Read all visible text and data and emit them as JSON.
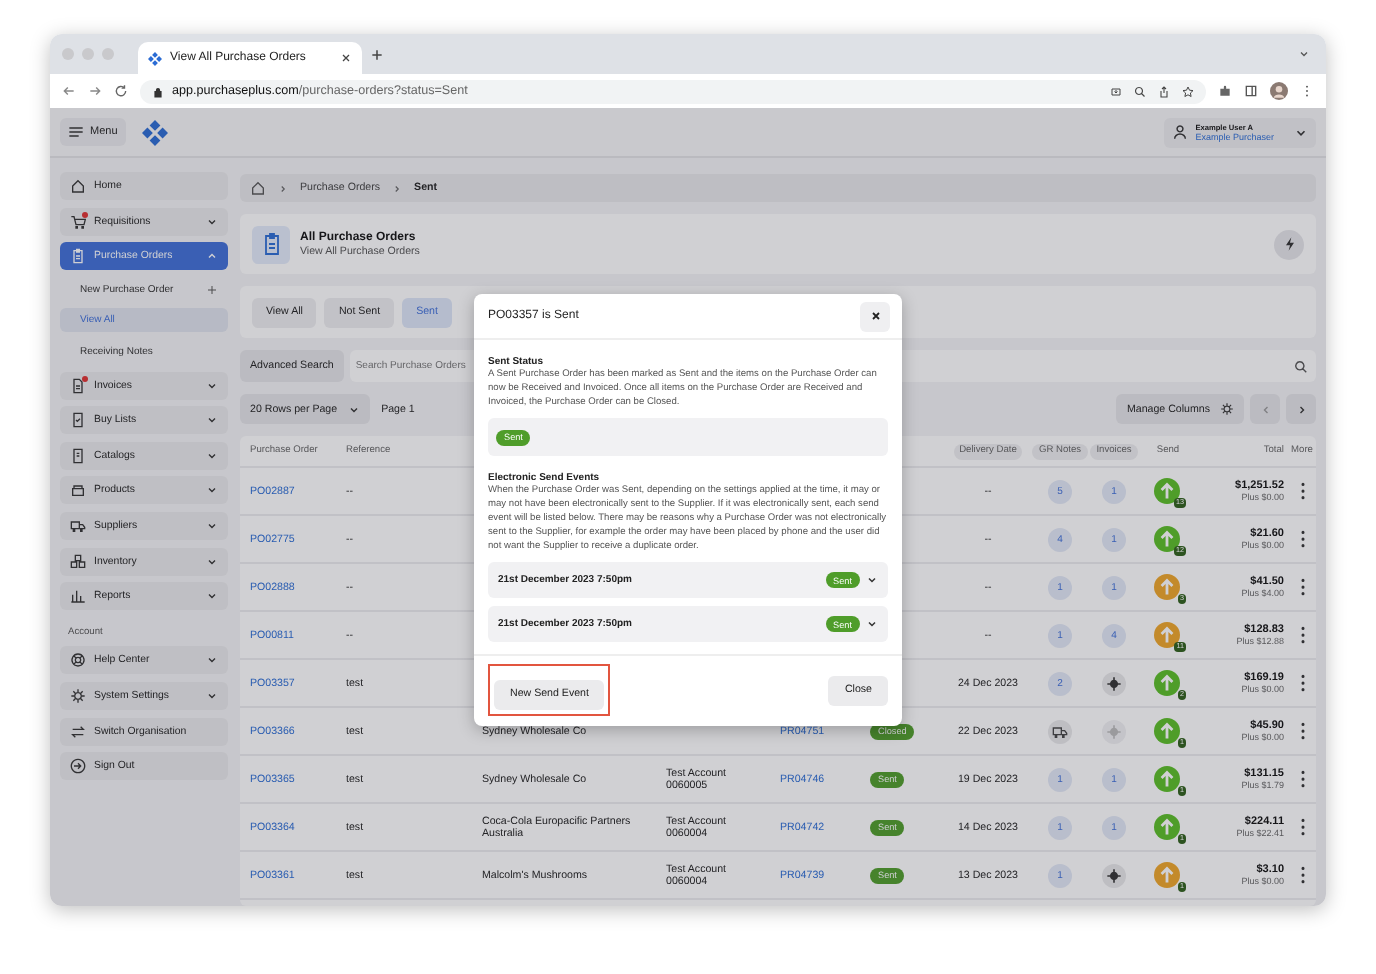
{
  "browser": {
    "tab_title": "View All Purchase Orders",
    "url": "**app.purchaseplus.com**/purchase-orders?status=Sent"
  },
  "header": {
    "menu_label": "Menu",
    "user_name": "Example User A",
    "user_role": "Example Purchaser"
  },
  "sidebar": {
    "sections": [
      {
        "items": [
          {
            "label": "Home",
            "selected": false
          },
          {
            "label": "Requisitions",
            "selected": false,
            "expanded": false,
            "notification": true
          },
          {
            "label": "Purchase Orders",
            "selected": true,
            "expanded": true,
            "notification": false,
            "children": [
              {
                "label": "New Purchase Order",
                "selected": false,
                "kind": "add"
              },
              {
                "label": "View All",
                "selected": true,
                "kind": "link"
              },
              {
                "label": "Receiving Notes",
                "selected": false,
                "kind": "link"
              }
            ]
          },
          {
            "label": "Invoices",
            "selected": false,
            "expanded": false,
            "notification": true
          },
          {
            "label": "Buy Lists",
            "selected": false,
            "expanded": false,
            "notification": false
          },
          {
            "label": "Catalogs",
            "selected": false,
            "expanded": false,
            "notification": false
          },
          {
            "label": "Products",
            "selected": false,
            "expanded": false,
            "notification": false
          },
          {
            "label": "Suppliers",
            "selected": false,
            "expanded": false,
            "notification": false
          },
          {
            "label": "Inventory",
            "selected": false,
            "expanded": false,
            "notification": false
          },
          {
            "label": "Reports",
            "selected": false,
            "expanded": false,
            "notification": false
          }
        ]
      },
      {
        "title": "Account",
        "items": [
          {
            "label": "Help Center",
            "selected": false,
            "expanded": false
          },
          {
            "label": "System Settings",
            "selected": false,
            "expanded": false
          },
          {
            "label": "Switch Organisation",
            "selected": false
          },
          {
            "label": "Sign Out",
            "selected": false
          }
        ]
      }
    ]
  },
  "breadcrumb": [
    "Purchase Orders",
    "Sent"
  ],
  "page": {
    "title": "All Purchase Orders",
    "subtitle": "View All Purchase Orders"
  },
  "filter_tabs": [
    {
      "label": "View All",
      "selected": false
    },
    {
      "label": "Not Sent",
      "selected": false
    },
    {
      "label": "Sent",
      "selected": true
    }
  ],
  "search": {
    "button": "Advanced Search",
    "placeholder": "Search Purchase Orders"
  },
  "pager": {
    "rows_per_page": "20 Rows per Page",
    "page": "Page 1",
    "manage_columns": "Manage Columns"
  },
  "table": {
    "columns": [
      "Purchase Order",
      "Reference",
      "",
      "",
      "",
      "",
      "Delivery Date",
      "GR Notes",
      "Invoices",
      "Send",
      "Total",
      "More"
    ],
    "rows": [
      {
        "po": "PO02887",
        "reference": "--",
        "delivery_date": "--",
        "gr_notes": {
          "kind": "count",
          "text": "5"
        },
        "invoices": {
          "kind": "count",
          "text": "1"
        },
        "send": {
          "count": "13",
          "color": "#4f9d2a"
        },
        "total": "$1,251.52",
        "tax": "Plus $0.00"
      },
      {
        "po": "PO02775",
        "reference": "--",
        "delivery_date": "--",
        "gr_notes": {
          "kind": "count",
          "text": "4"
        },
        "invoices": {
          "kind": "count",
          "text": "1"
        },
        "send": {
          "count": "12",
          "color": "#4f9d2a"
        },
        "total": "$21.60",
        "tax": "Plus $0.00"
      },
      {
        "po": "PO02888",
        "reference": "--",
        "delivery_date": "--",
        "gr_notes": {
          "kind": "count",
          "text": "1"
        },
        "invoices": {
          "kind": "count",
          "text": "1"
        },
        "send": {
          "count": "3",
          "color": "#c38a2b"
        },
        "total": "$41.50",
        "tax": "Plus $4.00"
      },
      {
        "po": "PO00811",
        "reference": "--",
        "delivery_date": "--",
        "gr_notes": {
          "kind": "count",
          "text": "1"
        },
        "invoices": {
          "kind": "count",
          "text": "4"
        },
        "send": {
          "count": "11",
          "color": "#c38a2b"
        },
        "total": "$128.83",
        "tax": "Plus $12.88"
      },
      {
        "po": "PO03357",
        "reference": "test",
        "delivery_date": "24 Dec 2023",
        "gr_notes": {
          "kind": "count",
          "text": "2"
        },
        "invoices": {
          "kind": "icon",
          "disabled": false
        },
        "send": {
          "count": "2",
          "color": "#4f9d2a"
        },
        "total": "$169.19",
        "tax": "Plus $0.00"
      },
      {
        "po": "PO03366",
        "reference": "test",
        "supplier": "Sydney Wholesale Co",
        "pr": "PR04751",
        "status": "Closed",
        "delivery_date": "22 Dec 2023",
        "gr_notes": {
          "kind": "truck"
        },
        "invoices": {
          "kind": "icon",
          "disabled": true
        },
        "send": {
          "count": "1",
          "color": "#4f9d2a"
        },
        "total": "$45.90",
        "tax": "Plus $0.00"
      },
      {
        "po": "PO03365",
        "reference": "test",
        "supplier": "Sydney Wholesale Co",
        "account": "Test Account 0060005",
        "pr": "PR04746",
        "status": "Sent",
        "delivery_date": "19 Dec 2023",
        "gr_notes": {
          "kind": "count",
          "text": "1"
        },
        "invoices": {
          "kind": "count",
          "text": "1"
        },
        "send": {
          "count": "1",
          "color": "#4f9d2a"
        },
        "total": "$131.15",
        "tax": "Plus $1.79"
      },
      {
        "po": "PO03364",
        "reference": "test",
        "supplier": "Coca-Cola Europacific Partners Australia",
        "account": "Test Account 0060004",
        "pr": "PR04742",
        "status": "Sent",
        "delivery_date": "14 Dec 2023",
        "gr_notes": {
          "kind": "count",
          "text": "1"
        },
        "invoices": {
          "kind": "count",
          "text": "1"
        },
        "send": {
          "count": "1",
          "color": "#4f9d2a"
        },
        "total": "$224.11",
        "tax": "Plus $22.41"
      },
      {
        "po": "PO03361",
        "reference": "test",
        "supplier": "Malcolm's Mushrooms",
        "account": "Test Account 0060004",
        "pr": "PR04739",
        "status": "Sent",
        "delivery_date": "13 Dec 2023",
        "gr_notes": {
          "kind": "count",
          "text": "1"
        },
        "invoices": {
          "kind": "icon",
          "disabled": false
        },
        "send": {
          "count": "1",
          "color": "#c38a2b"
        },
        "total": "$3.10",
        "tax": "Plus $0.00"
      }
    ]
  },
  "modal": {
    "title": "PO03357 is Sent",
    "status_heading": "Sent Status",
    "status_text": "A Sent Purchase Order has been marked as Sent and the items on the Purchase Order can now be Received and Invoiced. Once all items on the Purchase Order are Received and Invoiced, the Purchase Order can be Closed.",
    "status_pill": "Sent",
    "events_heading": "Electronic Send Events",
    "events_text": "When the Purchase Order was Sent, depending on the settings applied at the time, it may or may not have been electronically sent to the Supplier. If it was electronically sent, each send event will be listed below. There may be reasons why a Purchase Order was not electronically sent to the Supplier, for example the order may have been placed by phone and the user did not want the Supplier to receive a duplicate order.",
    "events": [
      {
        "date": "21st December 2023 7:50pm",
        "status": "Sent",
        "expanded": false
      },
      {
        "date": "21st December 2023 7:50pm",
        "status": "Sent",
        "expanded": false
      }
    ],
    "new_event_button": {
      "label": "New Send Event",
      "highlighted": true
    },
    "close_button": "Close"
  }
}
